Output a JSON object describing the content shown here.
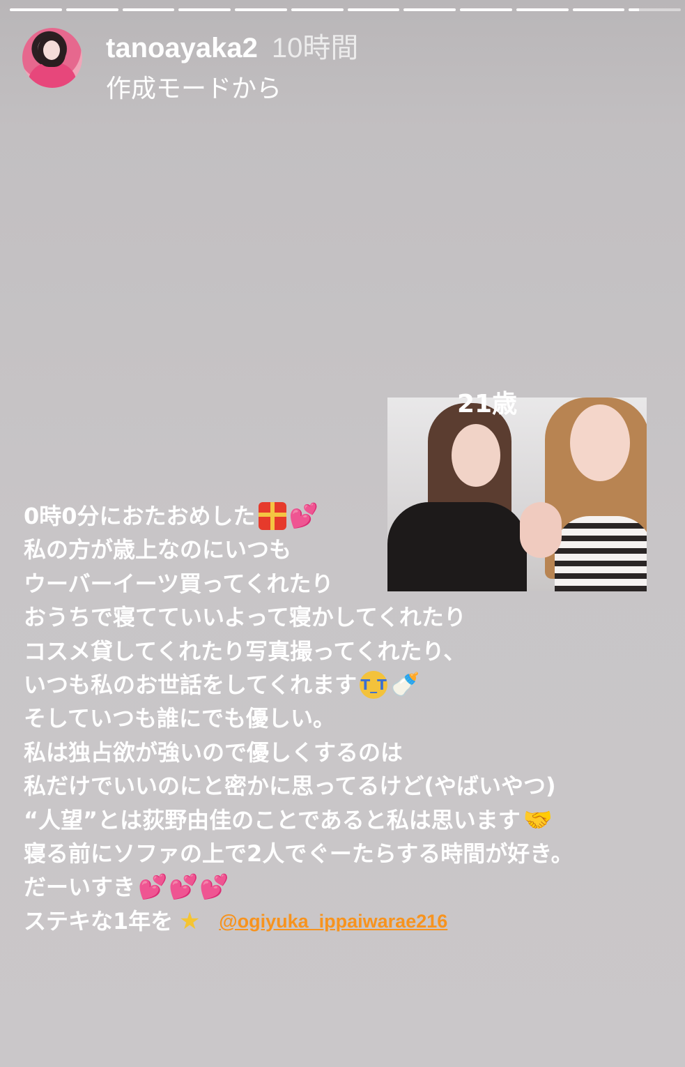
{
  "progress": {
    "segments_total": 12,
    "segments_completed": 11,
    "current_segment_fill": 0.2
  },
  "story": {
    "username": "tanoayaka2",
    "time": "10時間",
    "subtitle": "作成モードから"
  },
  "photo": {
    "caption": "21歳"
  },
  "message": {
    "lines": [
      "0時0分におたおめした",
      "私の方が歳上なのにいつも",
      "ウーバーイーツ買ってくれたり",
      "おうちで寝てていいよって寝かしてくれたり",
      "コスメ貸してくれたり写真撮ってくれたり、",
      "いつも私のお世話をしてくれます",
      "そしていつも誰にでも優しい。",
      "私は独占欲が強いので優しくするのは",
      "私だけでいいのにと密かに思ってるけど(やばいやつ)",
      "“人望”とは荻野由佳のことであると私は思います",
      "寝る前にソファの上で2人でぐーたらする時間が好き。",
      "だーいすき",
      "ステキな1年を"
    ],
    "mention": "@ogiyuka_ippaiwarae216"
  },
  "emojis": {
    "gift": "gift-emoji",
    "two_hearts": "two-hearts-emoji",
    "crying_face": "loudly-crying-face-emoji",
    "baby_bottle": "baby-bottle-emoji",
    "handshake": "handshake-emoji",
    "glowing_star": "glowing-star-emoji"
  },
  "colors": {
    "mention": "#f7931e",
    "text": "#ffffff"
  }
}
